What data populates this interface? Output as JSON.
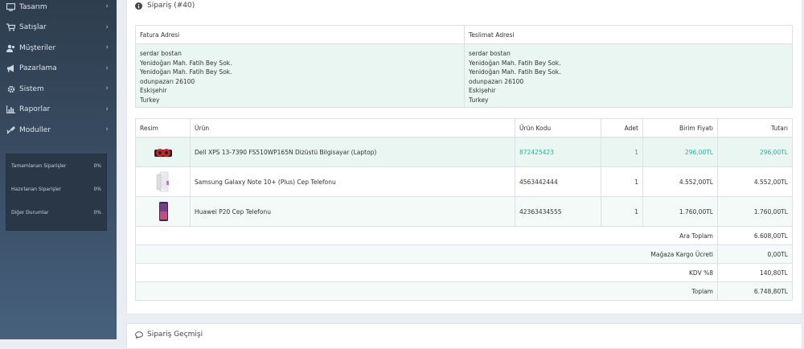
{
  "sidebar": {
    "items": [
      {
        "label": "Tasarım",
        "icon": "monitor-icon"
      },
      {
        "label": "Satışlar",
        "icon": "cart-icon"
      },
      {
        "label": "Müşteriler",
        "icon": "users-icon"
      },
      {
        "label": "Pazarlama",
        "icon": "bullhorn-icon"
      },
      {
        "label": "Sistem",
        "icon": "gear-icon"
      },
      {
        "label": "Raporlar",
        "icon": "bar-chart-icon"
      },
      {
        "label": "Moduller",
        "icon": "puzzle-icon"
      }
    ],
    "stats": [
      {
        "label": "Tamamlanan Siparişler",
        "value": "0%"
      },
      {
        "label": "Hazırlanan Siparişler",
        "value": "0%"
      },
      {
        "label": "Diğer Durumlar",
        "value": "0%"
      }
    ]
  },
  "order_panel": {
    "title": "Sipariş (#40)",
    "address": {
      "billing_header": "Fatura Adresi",
      "shipping_header": "Teslimat Adresi",
      "billing": {
        "name": "serdar bostan",
        "line1": "Yenidoğan Mah. Fatih Bey Sok.",
        "line2": "Yenidoğan Mah. Fatih Bey Sok.",
        "city_zip": "odunpazarı 26100",
        "region": "Eskişehir",
        "country": "Turkey"
      },
      "shipping": {
        "name": "serdar bostan",
        "line1": "Yenidoğan Mah. Fatih Bey Sok.",
        "line2": "Yenidoğan Mah. Fatih Bey Sok.",
        "city_zip": "odunpazarı 26100",
        "region": "Eskişehir",
        "country": "Turkey"
      }
    },
    "products": {
      "headers": {
        "image": "Resim",
        "product": "Ürün",
        "code": "Ürün Kodu",
        "qty": "Adet",
        "unit_price": "Birim Fiyatı",
        "total": "Tutarı"
      },
      "rows": [
        {
          "name": "Dell XPS 13-7390 FS510WP165N Dizüstü Bilgisayar (Laptop)",
          "code": "872425423",
          "qty": "1",
          "unit_price": "296,00TL",
          "total": "296,00TL"
        },
        {
          "name": "Samsung Galaxy Note 10+ (Plus) Cep Telefonu",
          "code": "4563442444",
          "qty": "1",
          "unit_price": "4.552,00TL",
          "total": "4.552,00TL"
        },
        {
          "name": "Huawei P20 Cep Telefonu",
          "code": "42363434555",
          "qty": "1",
          "unit_price": "1.760,00TL",
          "total": "1.760,00TL"
        }
      ],
      "summary": [
        {
          "label": "Ara Toplam",
          "value": "6.608,00TL"
        },
        {
          "label": "Mağaza Kargo Ücreti",
          "value": "0,00TL"
        },
        {
          "label": "KDV %8",
          "value": "140,80TL"
        },
        {
          "label": "Toplam",
          "value": "6.748,80TL"
        }
      ]
    }
  },
  "history_panel": {
    "title": "Sipariş Geçmişi"
  }
}
